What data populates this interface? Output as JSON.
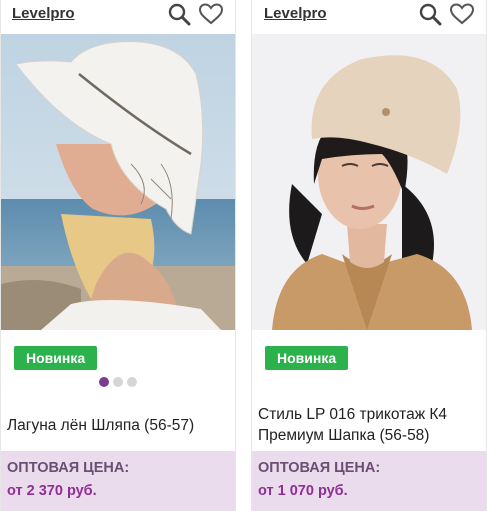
{
  "products": [
    {
      "brand": "Levelpro",
      "badge": "Новинка",
      "title": "Лагуна лён Шляпа (56-57)",
      "price_label": "ОПТОВАЯ ЦЕНА:",
      "price": "от 2 370 руб.",
      "gallery_total": 3,
      "gallery_active": 1
    },
    {
      "brand": "Levelpro",
      "badge": "Новинка",
      "title": "Стиль LP 016 трикотаж К4 Премиум Шапка (56-58)",
      "price_label": "ОПТОВАЯ ЦЕНА:",
      "price": "от 1 070 руб."
    }
  ],
  "icons": [
    "search-icon",
    "heart-icon"
  ],
  "colors": {
    "badge": "#2bb24c",
    "price_bg": "#eadcec",
    "price_text": "#8d2f93",
    "dot_active": "#7a3b91"
  }
}
